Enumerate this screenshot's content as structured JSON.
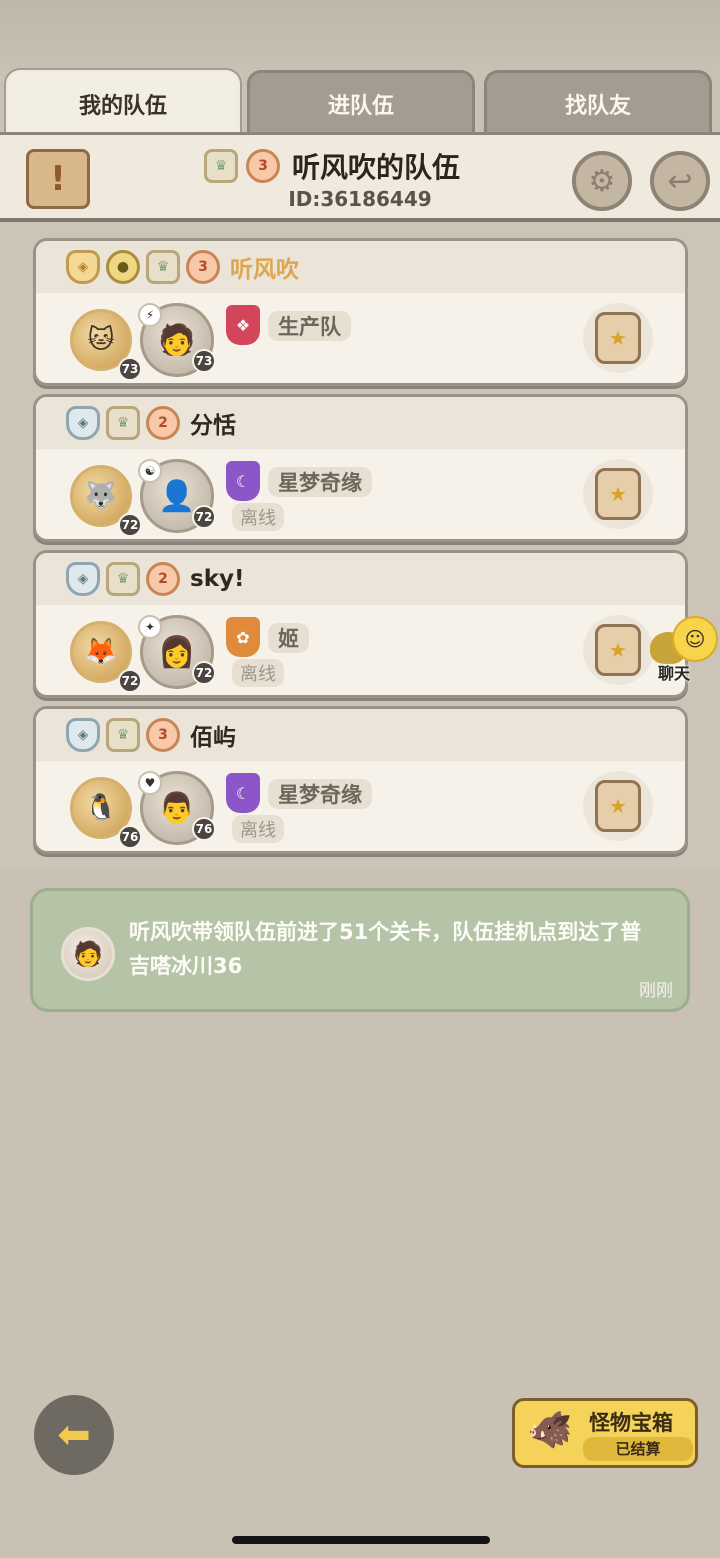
{
  "tabs": [
    {
      "label": "我的队伍",
      "active": true
    },
    {
      "label": "进队伍",
      "active": false
    },
    {
      "label": "找队友",
      "active": false
    }
  ],
  "header": {
    "title": "听风吹的队伍",
    "id_text": "ID:36186449",
    "scroll_icon": "scroll-exclaim-icon",
    "settings_icon": "gear-icon",
    "exit_icon": "exit-arrow-icon"
  },
  "members": [
    {
      "name": "听风吹",
      "is_leader": true,
      "pet_level": "73",
      "char_level": "73",
      "guild": "生产队",
      "status": "",
      "guild_color": "#d3455b"
    },
    {
      "name": "分恬",
      "is_leader": false,
      "pet_level": "72",
      "char_level": "72",
      "guild": "星梦奇缘",
      "status": "离线",
      "guild_color": "#8b56c8"
    },
    {
      "name": "sky!",
      "is_leader": false,
      "pet_level": "72",
      "char_level": "72",
      "guild": "姬",
      "status": "离线",
      "guild_color": "#e08a3c"
    },
    {
      "name": "佰屿",
      "is_leader": false,
      "pet_level": "76",
      "char_level": "76",
      "guild": "星梦奇缘",
      "status": "离线",
      "guild_color": "#8b56c8"
    }
  ],
  "chat": {
    "label": "聊天"
  },
  "notice": {
    "text": "听风吹带领队伍前进了51个关卡，队伍挂机点到达了普吉嗒冰川36",
    "time": "刚刚"
  },
  "treasure": {
    "title": "怪物宝箱",
    "status": "已结算"
  },
  "colors": {
    "accent_leader": "#e0a54f",
    "notice_bg": "#b5c4a6",
    "treasure_bg": "#f5d35a"
  }
}
